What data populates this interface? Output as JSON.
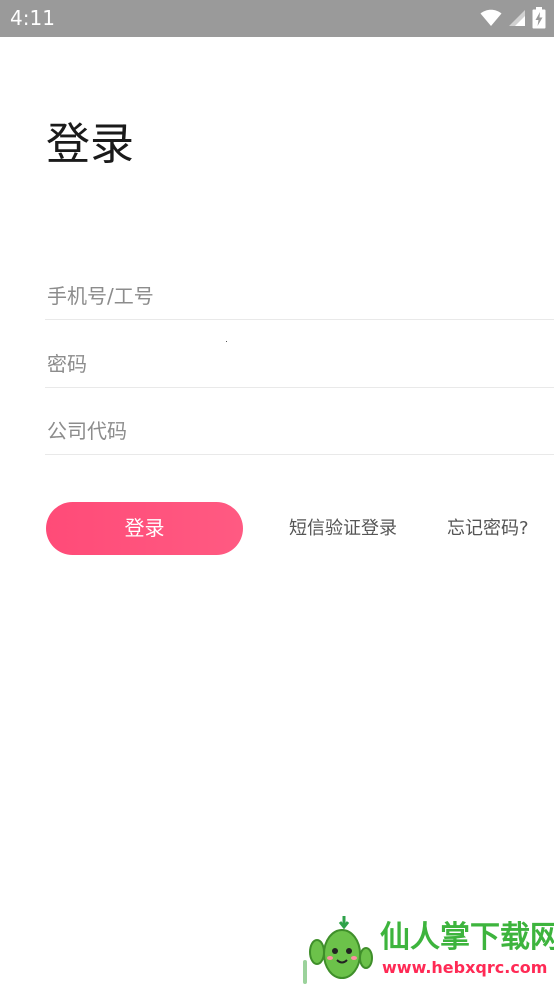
{
  "status_bar": {
    "time": "4:11",
    "icons": [
      "wifi-icon",
      "signal-icon",
      "battery-charging-icon"
    ]
  },
  "page": {
    "title": "登录"
  },
  "form": {
    "phone_placeholder": "手机号/工号",
    "password_placeholder": "密码",
    "company_placeholder": "公司代码"
  },
  "actions": {
    "login_label": "登录",
    "sms_login_label": "短信验证登录",
    "forgot_password_label": "忘记密码?"
  },
  "watermark": {
    "title": "仙人掌下载网",
    "url": "www.hebxqrc.com"
  },
  "colors": {
    "status_bar": "#9a9a9a",
    "accent": "#ff4b78",
    "watermark_green": "#3db43d",
    "watermark_red": "#ff2a55"
  }
}
